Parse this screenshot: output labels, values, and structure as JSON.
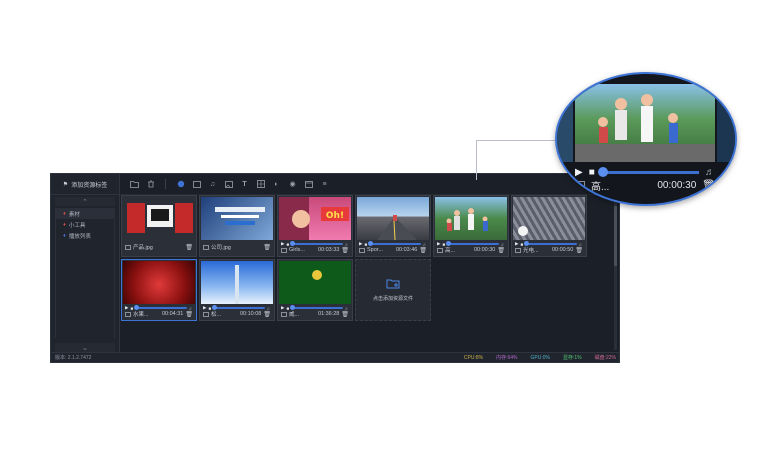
{
  "sidebar": {
    "header": "添加资源标签",
    "items": [
      {
        "label": "素材",
        "icon": "tag-icon",
        "color": "#d04a4a"
      },
      {
        "label": "小工具",
        "icon": "tag-icon",
        "color": "#d04a4a"
      },
      {
        "label": "播放列表",
        "icon": "tag-icon",
        "color": "#4a6fd0"
      }
    ]
  },
  "toolbar": {
    "icons": [
      "folder-add-icon",
      "trash-icon",
      "video-icon",
      "image-icon",
      "music-icon",
      "picture-icon",
      "text-icon",
      "grid-icon",
      "audio-icon",
      "globe-icon",
      "window-icon",
      "stream-icon"
    ]
  },
  "cards": [
    {
      "name": "产品.jpg",
      "duration": "",
      "kind": "image",
      "scene": "red-promo"
    },
    {
      "name": "公司.jpg",
      "duration": "",
      "kind": "image",
      "scene": "led-poster"
    },
    {
      "name": "Girls...",
      "duration": "00:03:33",
      "kind": "video",
      "scene": "oh-poster"
    },
    {
      "name": "Spor...",
      "duration": "00:03:46",
      "kind": "video",
      "scene": "road"
    },
    {
      "name": "高...",
      "duration": "00:00:30",
      "kind": "video",
      "scene": "family"
    },
    {
      "name": "光电...",
      "duration": "00:00:50",
      "kind": "video",
      "scene": "led-wall"
    },
    {
      "name": "水果...",
      "duration": "00:04:31",
      "kind": "video",
      "scene": "rose",
      "selected": true
    },
    {
      "name": "松...",
      "duration": "00:10:08",
      "kind": "video",
      "scene": "sky-tower"
    },
    {
      "name": "威...",
      "duration": "01:36:28",
      "kind": "video",
      "scene": "green-logo"
    }
  ],
  "add_card": {
    "label": "点击添加资源文件"
  },
  "status": {
    "version": "版本: 2.1.2.7472",
    "cpu": "CPU:8%",
    "memory": "内存:64%",
    "gpu": "GPU:0%",
    "vram": "显存:1%",
    "disk": "磁盘:22%"
  },
  "zoom": {
    "name": "高...",
    "duration": "00:00:30"
  },
  "colors": {
    "accent": "#3d74d6",
    "cpu": "#c8b14a",
    "memory": "#b46ad0",
    "gpu": "#4fb0c8",
    "vram": "#4fc878",
    "disk": "#d06a9a"
  }
}
